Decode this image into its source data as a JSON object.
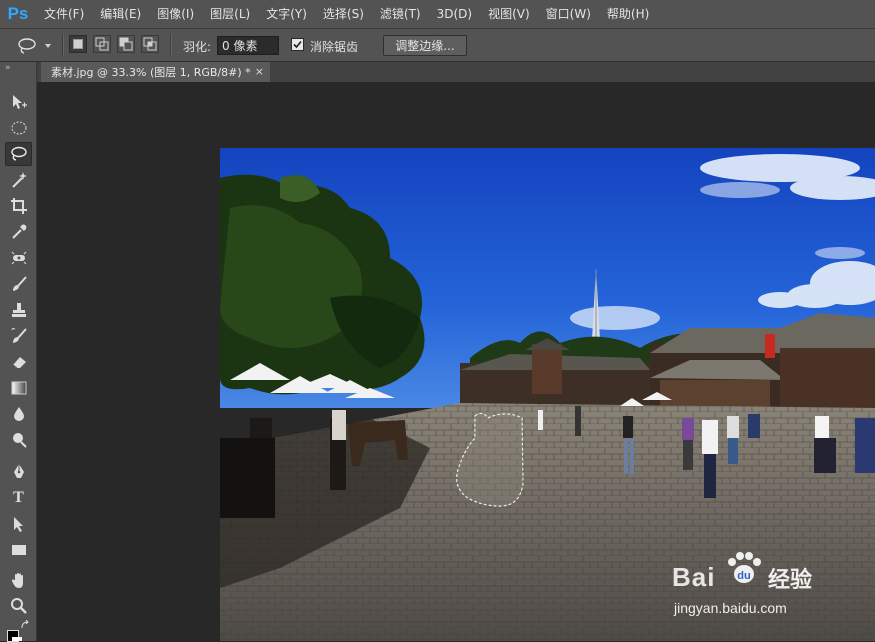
{
  "app": {
    "logo": "Ps"
  },
  "menu": [
    "文件(F)",
    "编辑(E)",
    "图像(I)",
    "图层(L)",
    "文字(Y)",
    "选择(S)",
    "滤镜(T)",
    "3D(D)",
    "视图(V)",
    "窗口(W)",
    "帮助(H)"
  ],
  "options": {
    "feather_label": "羽化:",
    "feather_value": "0 像素",
    "antialias_label": "消除锯齿",
    "antialias_checked": true,
    "refine_edge_label": "调整边缘..."
  },
  "document": {
    "tab_title": "素材.jpg @ 33.3% (图层 1, RGB/8#) *",
    "close_glyph": "×"
  },
  "toolbar": {
    "collapse_glyph": "»",
    "tools": [
      "move-tool",
      "marquee-tool",
      "lasso-tool",
      "magic-wand-tool",
      "crop-tool",
      "eyedropper-tool",
      "healing-brush-tool",
      "brush-tool",
      "clone-stamp-tool",
      "history-brush-tool",
      "eraser-tool",
      "gradient-tool",
      "blur-tool",
      "dodge-tool",
      "pen-tool",
      "type-tool",
      "path-selection-tool",
      "rectangle-tool",
      "hand-tool",
      "zoom-tool"
    ],
    "active_tool": "lasso-tool",
    "type_tool_glyph": "T"
  },
  "watermark": {
    "brand": "Bai",
    "brand2": "经验",
    "url": "jingyan.baidu.com"
  },
  "colors": {
    "ui_bg": "#535353",
    "canvas_bg": "#282828",
    "accent": "#31a8ff",
    "sky": "#1f56c8"
  }
}
